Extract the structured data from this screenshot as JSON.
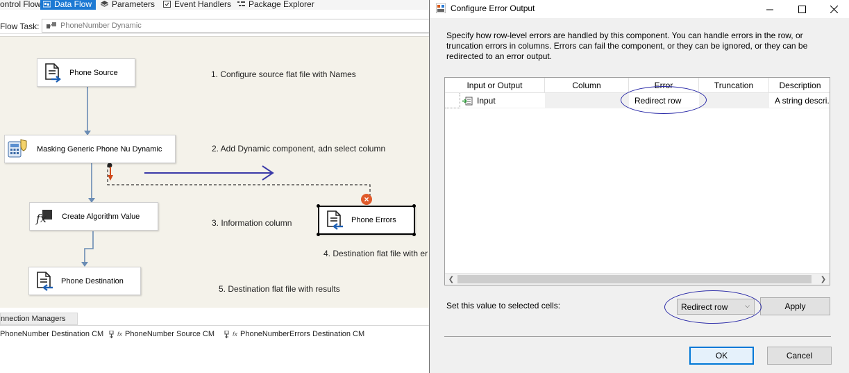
{
  "designer": {
    "tabs": [
      {
        "label": "ontrol Flow",
        "active": false,
        "icon": "control-flow-icon"
      },
      {
        "label": "Data Flow",
        "active": true,
        "icon": "data-flow-icon"
      },
      {
        "label": "Parameters",
        "active": false,
        "icon": "parameters-icon"
      },
      {
        "label": "Event Handlers",
        "active": false,
        "icon": "event-handlers-icon"
      },
      {
        "label": "Package Explorer",
        "active": false,
        "icon": "package-explorer-icon"
      }
    ],
    "task_label": "Flow Task:",
    "task_value": "PhoneNumber Dynamic",
    "nodes": {
      "source": "Phone Source",
      "masking": "Masking Generic Phone Nu Dynamic",
      "algorithm": "Create Algorithm Value",
      "destination": "Phone Destination",
      "errors": "Phone Errors"
    },
    "notes": {
      "n1": "1. Configure source flat file with Names",
      "n2": "2. Add Dynamic component, adn select column",
      "n3": "3. Information column",
      "n4": "4. Destination flat file with er",
      "n5": "5. Destination flat file with results"
    },
    "connection_managers": {
      "tab_label": "nnection Managers",
      "items": [
        "PhoneNumber Destination CM",
        "PhoneNumber Source CM",
        "PhoneNumberErrors Destination CM"
      ]
    }
  },
  "dialog": {
    "title": "Configure Error Output",
    "description": "Specify how row-level errors are handled by this component. You can handle errors in the row, or truncation errors in columns. Errors can fail the component, or they can be ignored, or they can be redirected to an error output.",
    "columns": [
      "Input or Output",
      "Column",
      "Error",
      "Truncation",
      "Description"
    ],
    "rows": [
      {
        "input_or_output": "Input",
        "column": "",
        "error": "Redirect row",
        "truncation": "",
        "description": "A string descri..."
      }
    ],
    "set_value_label": "Set this value to selected cells:",
    "set_value_selected": "Redirect row",
    "apply_label": "Apply",
    "ok_label": "OK",
    "cancel_label": "Cancel"
  },
  "colors": {
    "accent": "#1c79d3",
    "annotation": "#2b2ba8",
    "error_path": "#d04a1c",
    "canvas": "#f4f2ea"
  }
}
